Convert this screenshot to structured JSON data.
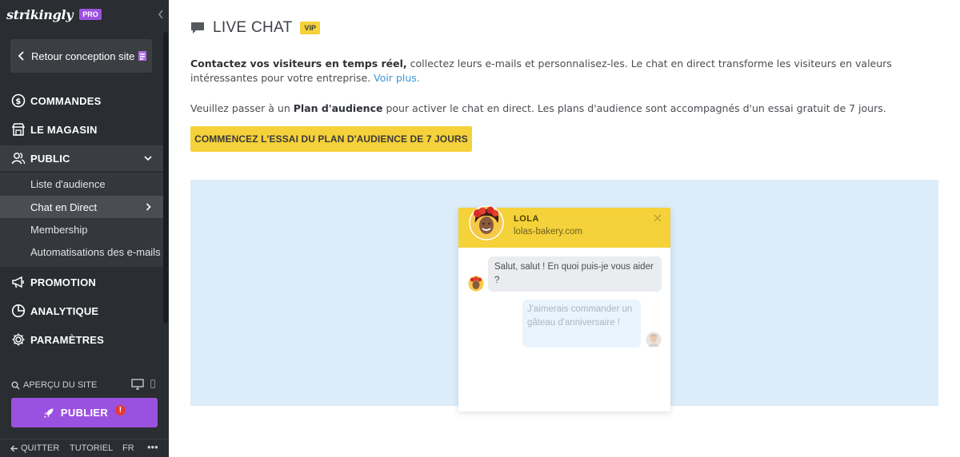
{
  "sidebar": {
    "logo": "strikingly",
    "plan_badge": "PRO",
    "back_label": "Retour conception site",
    "nav": {
      "commandes": "COMMANDES",
      "magasin": "LE MAGASIN",
      "public": "PUBLIC",
      "promotion": "PROMOTION",
      "analytique": "ANALYTIQUE",
      "parametres": "PARAMÈTRES"
    },
    "public_sub": [
      "Liste d'audience",
      "Chat en Direct",
      "Membership",
      "Automatisations des e-mails"
    ],
    "preview_label": "APERÇU DU SITE",
    "publish_label": "PUBLIER",
    "publish_warning": "!",
    "footer": {
      "quit": "QUITTER",
      "tutorial": "TUTORIEL",
      "lang": "FR",
      "more": "•••"
    }
  },
  "main": {
    "title": "LIVE CHAT",
    "badge": "VIP",
    "intro_bold": "Contactez vos visiteurs en temps réel,",
    "intro_text": " collectez leurs e-mails et personnalisez-les. Le chat en direct transforme les visiteurs en valeurs intéressantes pour votre entreprise.",
    "intro_link": "Voir plus.",
    "notice_pre": "Veuillez passer à un ",
    "notice_bold": "Plan d'audience",
    "notice_post": " pour activer le chat en direct. Les plans d'audience sont accompagnés d'un essai gratuit de 7 jours.",
    "trial_button": "COMMENCEZ L'ESSAI DU PLAN D'AUDIENCE DE 7 JOURS"
  },
  "chat_preview": {
    "agent_name": "LOLA",
    "agent_site": "lolas-bakery.com",
    "agent_message": "Salut, salut ! En quoi puis-je vous aider ?",
    "visitor_message": "J'aimerais commander un gâteau d'anniversaire !"
  },
  "colors": {
    "sidebar_bg": "#2a2d31",
    "accent_purple": "#9b51e0",
    "accent_yellow": "#f5d13a",
    "link_blue": "#3b99d6",
    "preview_bg": "#dcecf9"
  }
}
